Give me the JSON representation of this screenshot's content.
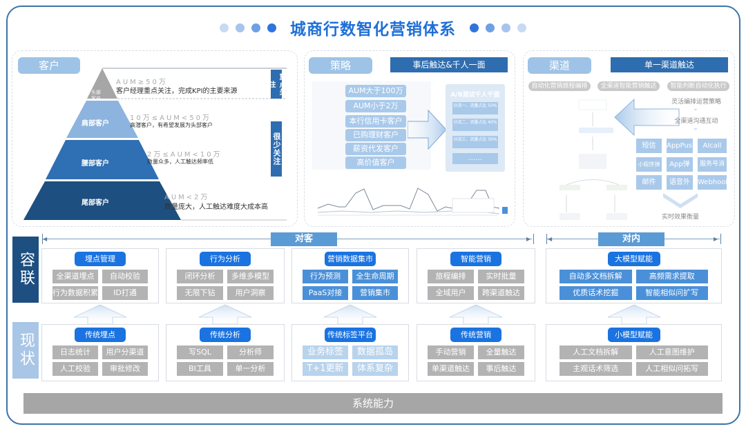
{
  "header": {
    "title": "城商行数智化营销体系",
    "dot_colors_left": [
      "#c8daf2",
      "#a6c4ee",
      "#6f9fe4",
      "#2f74dc"
    ],
    "dot_colors_right": [
      "#2f74dc",
      "#6f9fe4",
      "#a6c4ee",
      "#c8daf2"
    ]
  },
  "customer": {
    "tag": "客户",
    "tiers": [
      {
        "name": "头部客户",
        "aum": "AUM≥50万",
        "desc": "客户经理重点关注，完成KPI的主要来源",
        "color": "#a6a6a6"
      },
      {
        "name": "肩部客户",
        "aum": "10万≤AUM<50万",
        "desc": "高潜客户，有希望发展为头部客户",
        "color": "#8db4de"
      },
      {
        "name": "腰部客户",
        "aum": "2万≤AUM<10万",
        "desc": "数量众多，人工触达频率低",
        "color": "#2f6fb3"
      },
      {
        "name": "尾部客户",
        "aum": "AUM<2万",
        "desc": "数量庞大，人工触达难度大成本高",
        "color": "#1d4f80"
      }
    ],
    "focus_label": "重点关注",
    "little_focus_label": "很少关注"
  },
  "strategy": {
    "tag": "策略",
    "title": "事后触达&千人一面",
    "segments": [
      "AUM大于100万",
      "AUM小于2万",
      "本行信用卡客户",
      "已购理财客户",
      "薪资代发客户",
      "高价值客户"
    ],
    "ab_title": "A/B测试千人千面",
    "ab_groups": [
      "分流一，流量占比 50%",
      "分流二，流量占比 40%",
      "分流三，流量占比 30%",
      "……"
    ]
  },
  "channel": {
    "tag": "渠道",
    "title": "单一渠道触达",
    "pills": [
      "自动化营销旅程编排",
      "全渠道智能营销触达",
      "智能判断自动化执行"
    ],
    "steps": [
      "灵活编排运营策略",
      "全渠道沟通互动",
      "实时效果衡量"
    ],
    "channels": [
      "短信",
      "AppPush",
      "AIcall",
      "小程序弹窗",
      "App弹窗",
      "服务号消息",
      "邮件",
      "语音外呼",
      "Webhook"
    ]
  },
  "rows": {
    "top_label": "容联",
    "bottom_label": "现状",
    "to_customer": "对客",
    "to_internal": "对内"
  },
  "top_cards": [
    {
      "title": "埋点管理",
      "items": [
        "全渠道埋点",
        "自动校验",
        "行为数据积累",
        "ID打通"
      ],
      "style": "grey"
    },
    {
      "title": "行为分析",
      "items": [
        "闭环分析",
        "多维多模型",
        "无限下钻",
        "用户洞察"
      ],
      "style": "grey"
    },
    {
      "title": "营销数据集市",
      "items": [
        "行为预测",
        "全生命周期",
        "PaaS对接",
        "营销集市"
      ],
      "style": "blue"
    },
    {
      "title": "智能营销",
      "items": [
        "旅程编排",
        "实时批量",
        "全域用户",
        "跨渠道触达"
      ],
      "style": "grey"
    },
    {
      "title": "大模型赋能",
      "items": [
        "自动多文档拆解",
        "高频需求提取",
        "优质话术挖掘",
        "智能相似问扩写"
      ],
      "style": "blue"
    }
  ],
  "bottom_cards": [
    {
      "title": "传统埋点",
      "items": [
        "日志统计",
        "用户分渠道",
        "人工校验",
        "审批修改"
      ],
      "style": "grey"
    },
    {
      "title": "传统分析",
      "items": [
        "写SQL",
        "分析师",
        "BI工具",
        "单一分析"
      ],
      "style": "grey"
    },
    {
      "title": "传统标签平台",
      "items": [
        "业务标签",
        "数据孤岛",
        "T+1更新",
        "体系复杂"
      ],
      "style": "lightblue"
    },
    {
      "title": "传统营销",
      "items": [
        "手动营销",
        "全量触达",
        "单渠道触达",
        "事后触达"
      ],
      "style": "grey"
    },
    {
      "title": "小模型赋能",
      "items": [
        "人工文档拆解",
        "人工意图维护",
        "主观话术筛选",
        "人工相似问拓写"
      ],
      "style": "grey"
    }
  ],
  "footer": {
    "label": "系统能力"
  }
}
